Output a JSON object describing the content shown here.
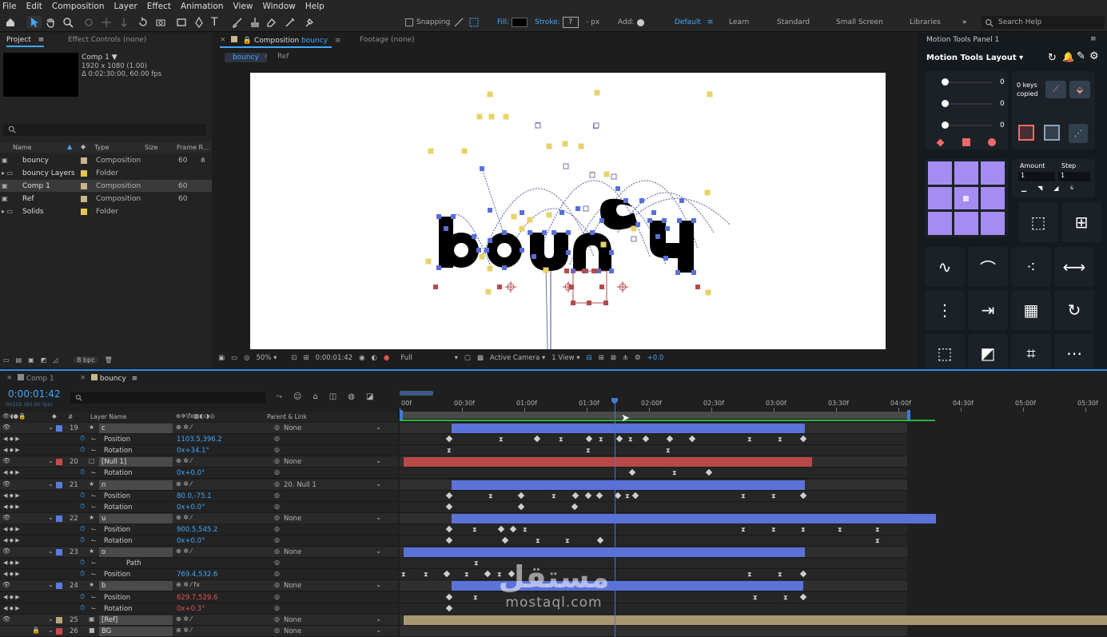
{
  "menu": [
    "File",
    "Edit",
    "Composition",
    "Layer",
    "Effect",
    "Animation",
    "View",
    "Window",
    "Help"
  ],
  "toolbar": {
    "snapping": "Snapping",
    "fill": "Fill:",
    "stroke": "Stroke:",
    "stroke_unit": "- px",
    "add": "Add:",
    "workspaces": [
      "Default",
      "Learn",
      "Standard",
      "Small Screen",
      "Libraries"
    ],
    "search_placeholder": "Search Help"
  },
  "project": {
    "tab_project": "Project",
    "tab_effects": "Effect Controls (none)",
    "comp_name": "Comp 1 ▼",
    "comp_size": "1920 x 1080 (1.00)",
    "comp_duration": "Δ 0:02:30:00, 60.00 fps",
    "columns": [
      "Name",
      "Type",
      "Size",
      "Frame R..."
    ],
    "items": [
      {
        "name": "bouncy",
        "type": "Composition",
        "rate": "60",
        "color": "#c9b58a"
      },
      {
        "name": "bouncy Layers",
        "type": "Folder",
        "rate": "",
        "color": "#e6c84a"
      },
      {
        "name": "Comp 1",
        "type": "Composition",
        "rate": "60",
        "color": "#c9b58a"
      },
      {
        "name": "Ref",
        "type": "Composition",
        "rate": "60",
        "color": "#c9b58a"
      },
      {
        "name": "Solids",
        "type": "Folder",
        "rate": "",
        "color": "#e6c84a"
      }
    ],
    "bpc": "8 bpc"
  },
  "composition": {
    "tab_label": "Composition",
    "tab_name": "bouncy",
    "footage_tab": "Footage (none)",
    "breadcrumbs": [
      "bouncy",
      "Ref"
    ],
    "zoom": "50%",
    "timecode": "0:00:01:42",
    "resolution": "Full",
    "camera": "Active Camera",
    "views": "1 View",
    "exposure": "+0.0"
  },
  "timeline": {
    "tabs": [
      "Comp 1",
      "bouncy"
    ],
    "current_time": "0:00:01:42",
    "frames": "00102 (60.00 fps)",
    "ruler": [
      "00f",
      "00:30f",
      "01:00f",
      "01:30f",
      "02:00f",
      "02:30f",
      "03:00f",
      "03:30f",
      "04:00f",
      "04:30f",
      "05:00f",
      "05:30f"
    ],
    "col_layer": "Layer Name",
    "col_parent": "Parent & Link",
    "rows": [
      {
        "type": "layer",
        "num": "19",
        "name": "c",
        "parent": "None",
        "label": "#5b7bdc"
      },
      {
        "type": "prop",
        "name": "Position",
        "value": "1103.5,396.2"
      },
      {
        "type": "prop",
        "name": "Rotation",
        "value": "0x+34.1°"
      },
      {
        "type": "layer",
        "num": "20",
        "name": "[Null 1]",
        "parent": "None",
        "label": "#c84a4a"
      },
      {
        "type": "prop",
        "name": "Rotation",
        "value": "0x+0.0°"
      },
      {
        "type": "layer",
        "num": "21",
        "name": "n",
        "parent": "20. Null 1",
        "label": "#5b7bdc"
      },
      {
        "type": "prop",
        "name": "Position",
        "value": "80.0,-75.1"
      },
      {
        "type": "prop",
        "name": "Rotation",
        "value": "0x+0.0°"
      },
      {
        "type": "layer",
        "num": "22",
        "name": "u",
        "parent": "None",
        "label": "#5b7bdc"
      },
      {
        "type": "prop",
        "name": "Position",
        "value": "900.5,545.2"
      },
      {
        "type": "prop",
        "name": "Rotation",
        "value": "0x+0.0°"
      },
      {
        "type": "layer",
        "num": "23",
        "name": "o",
        "parent": "None",
        "label": "#5b7bdc"
      },
      {
        "type": "prop",
        "name": "Path",
        "value": ""
      },
      {
        "type": "prop",
        "name": "Position",
        "value": "769.4,532.6"
      },
      {
        "type": "layer",
        "num": "24",
        "name": "b",
        "parent": "None",
        "label": "#5b7bdc"
      },
      {
        "type": "prop",
        "name": "Position",
        "value": "629.7,529.6"
      },
      {
        "type": "prop",
        "name": "Rotation",
        "value": "0x+0.3°"
      },
      {
        "type": "layer",
        "num": "25",
        "name": "[Ref]",
        "parent": "None",
        "label": "#b7a57e"
      },
      {
        "type": "layer",
        "num": "26",
        "name": "BG",
        "parent": "None",
        "label": "#c84a4a"
      }
    ]
  },
  "motion_tools": {
    "panel_title": "Motion Tools Panel 1",
    "layout_label": "Motion Tools Layout",
    "slider_values": [
      "0",
      "0",
      "0"
    ],
    "keys_copied": "0 keys copied",
    "amount_label": "Amount",
    "step_label": "Step",
    "amount_value": "1",
    "step_value": "1"
  },
  "watermark": {
    "arabic": "مستقل",
    "latin": "mostaql.com"
  },
  "colors": {
    "accent": "#2d8ceb",
    "layer_blue": "#5b72d9",
    "layer_red": "#b84848",
    "ref_tan": "#a89770",
    "mt_purple": "#a48cf2"
  }
}
